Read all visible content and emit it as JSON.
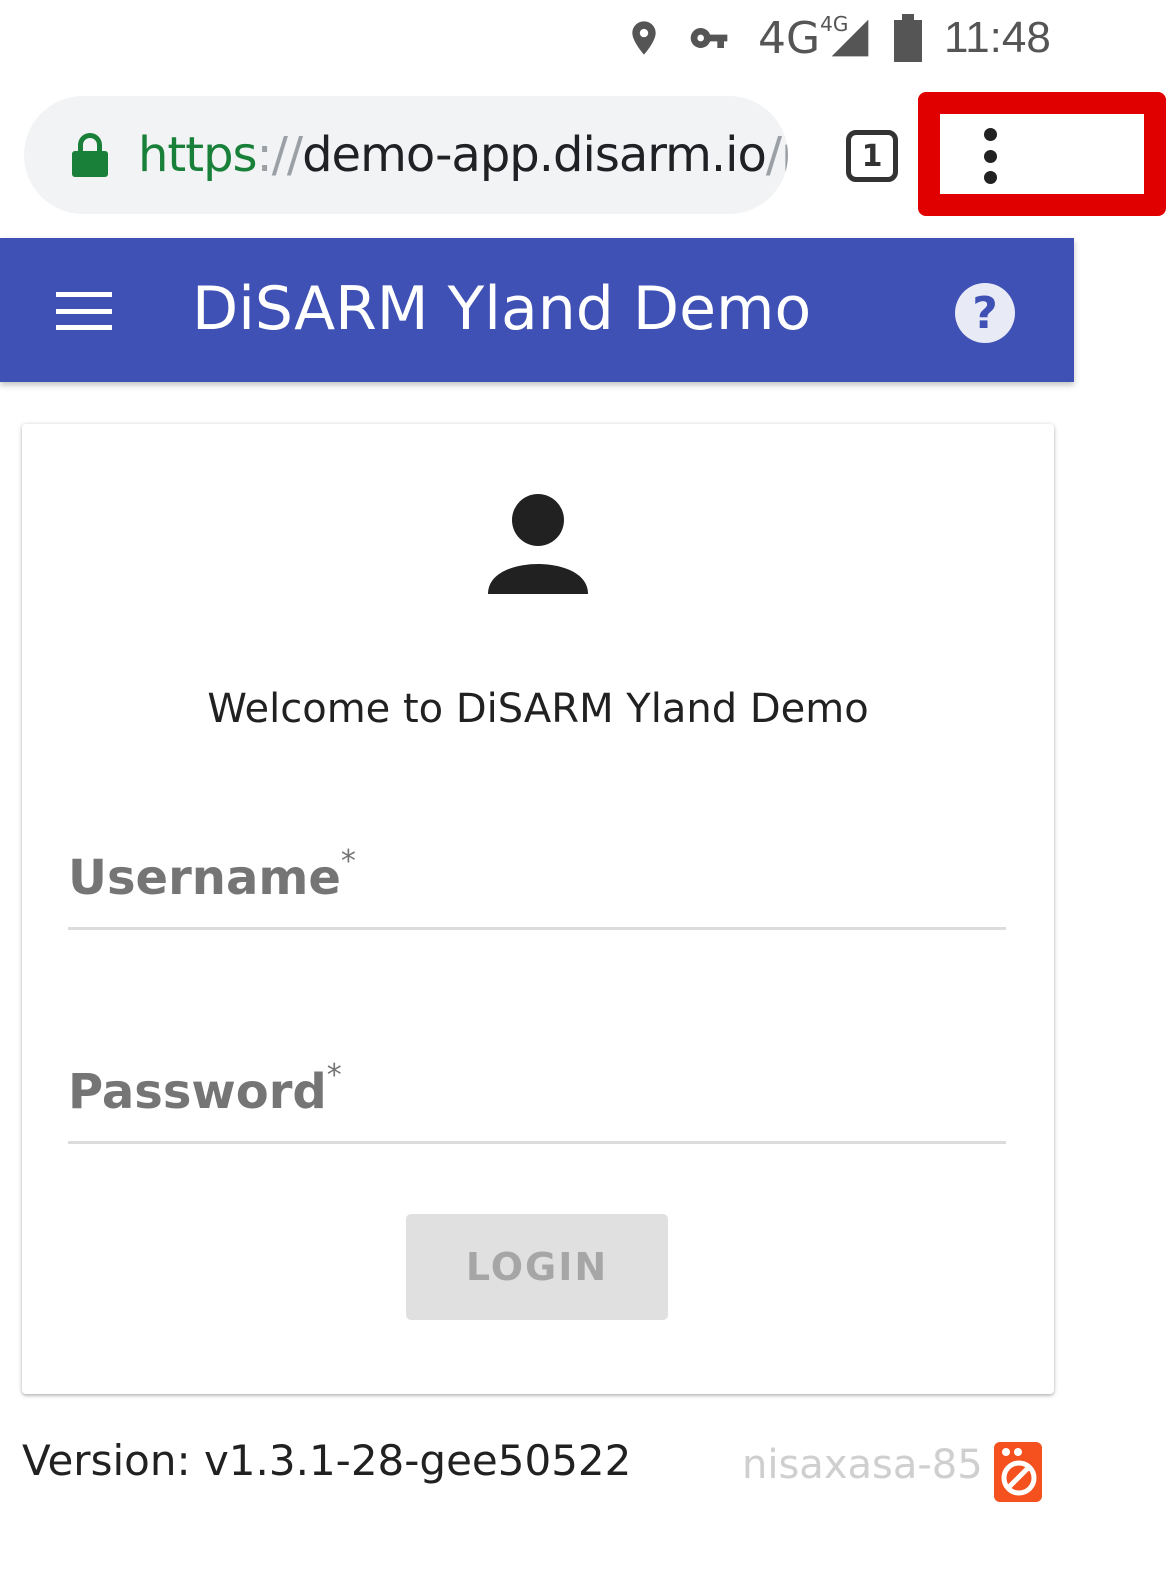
{
  "status_bar": {
    "network": "4G",
    "network_sup": "4G",
    "time": "11:48"
  },
  "browser": {
    "url_scheme": "https",
    "url_sep": "://",
    "url_host": "demo-app.disarm.io",
    "url_path": "/n",
    "tab_count": "1"
  },
  "app_bar": {
    "title": "DiSARM Yland Demo"
  },
  "login": {
    "welcome": "Welcome to DiSARM Yland Demo",
    "username_label": "Username",
    "password_label": "Password",
    "required_mark": "*",
    "username_value": "",
    "password_value": "",
    "login_label": "LOGIN"
  },
  "footer": {
    "version": "Version: v1.3.1-28-gee50522",
    "instance_name": "nisaxasa-85"
  },
  "colors": {
    "app_bar": "#3f51b5",
    "url_scheme": "#188038",
    "highlight": "#e00000",
    "instance_icon": "#f4511e"
  }
}
